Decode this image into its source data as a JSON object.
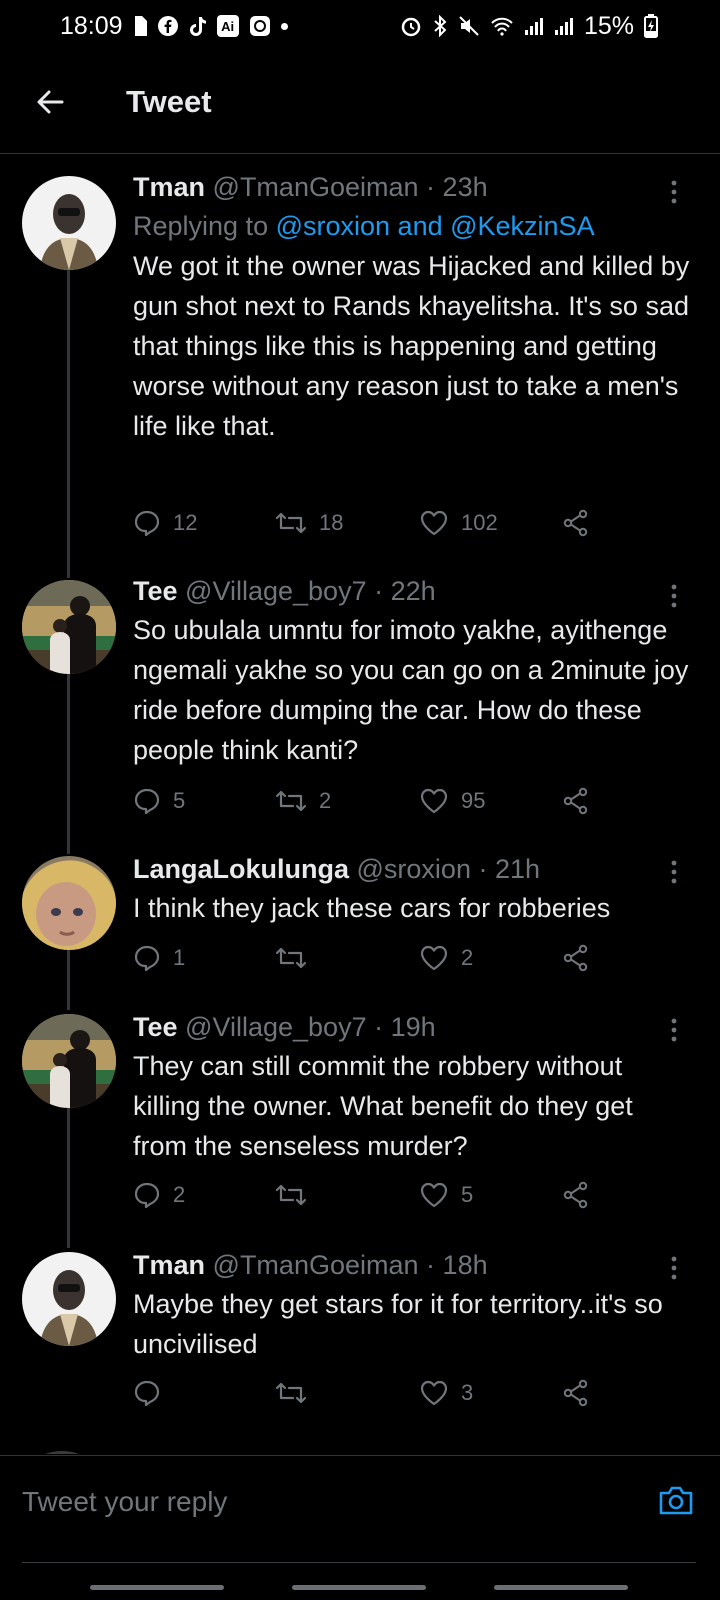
{
  "status_bar": {
    "time": "18:09",
    "battery": "15%",
    "left_icons": [
      "sim-icon",
      "facebook-icon",
      "tiktok-icon",
      "ai-icon",
      "gallery-icon",
      "dot-icon"
    ],
    "right_icons": [
      "alarm-icon",
      "bluetooth-icon",
      "mute-icon",
      "wifi-icon",
      "signal-icon",
      "signal-icon",
      "battery-charging-icon"
    ]
  },
  "header": {
    "title": "Tweet"
  },
  "colors": {
    "background": "#000000",
    "text": "#e7e9ea",
    "muted": "#71767b",
    "accent": "#1d9bf0",
    "divider": "#2f3336"
  },
  "tweets": [
    {
      "name": "Tman",
      "handle": "@TmanGoeiman",
      "separator": "·",
      "time": "23h",
      "replying_prefix": "Replying to",
      "replying_to": "@sroxion and @KekzinSA",
      "text": "We got it the owner was Hijacked and killed by gun shot next to Rands khayelitsha. It's so sad that things like this is happening and getting worse without any reason just to take a men's life like that.",
      "replies": "12",
      "retweets": "18",
      "likes": "102"
    },
    {
      "name": "Tee",
      "handle": "@Village_boy7",
      "separator": "·",
      "time": "22h",
      "text": "So ubulala umntu for imoto yakhe, ayithenge ngemali yakhe so you can go on a 2minute joy ride before dumping the car. How do these people think kanti?",
      "replies": "5",
      "retweets": "2",
      "likes": "95"
    },
    {
      "name": "LangaLokulunga",
      "handle": "@sroxion",
      "separator": "·",
      "time": "21h",
      "text": "I think they jack these cars for robberies",
      "replies": "1",
      "retweets": "",
      "likes": "2"
    },
    {
      "name": "Tee",
      "handle": "@Village_boy7",
      "separator": "·",
      "time": "19h",
      "text": "They can still commit the robbery without killing the owner. What benefit do they get from the senseless murder?",
      "replies": "2",
      "retweets": "",
      "likes": "5"
    },
    {
      "name": "Tman",
      "handle": "@TmanGoeiman",
      "separator": "·",
      "time": "18h",
      "text": "Maybe they get stars for it for territory..it's so uncivilised",
      "replies": "",
      "retweets": "",
      "likes": "3"
    }
  ],
  "reply_bar": {
    "placeholder": "Tweet your reply"
  }
}
